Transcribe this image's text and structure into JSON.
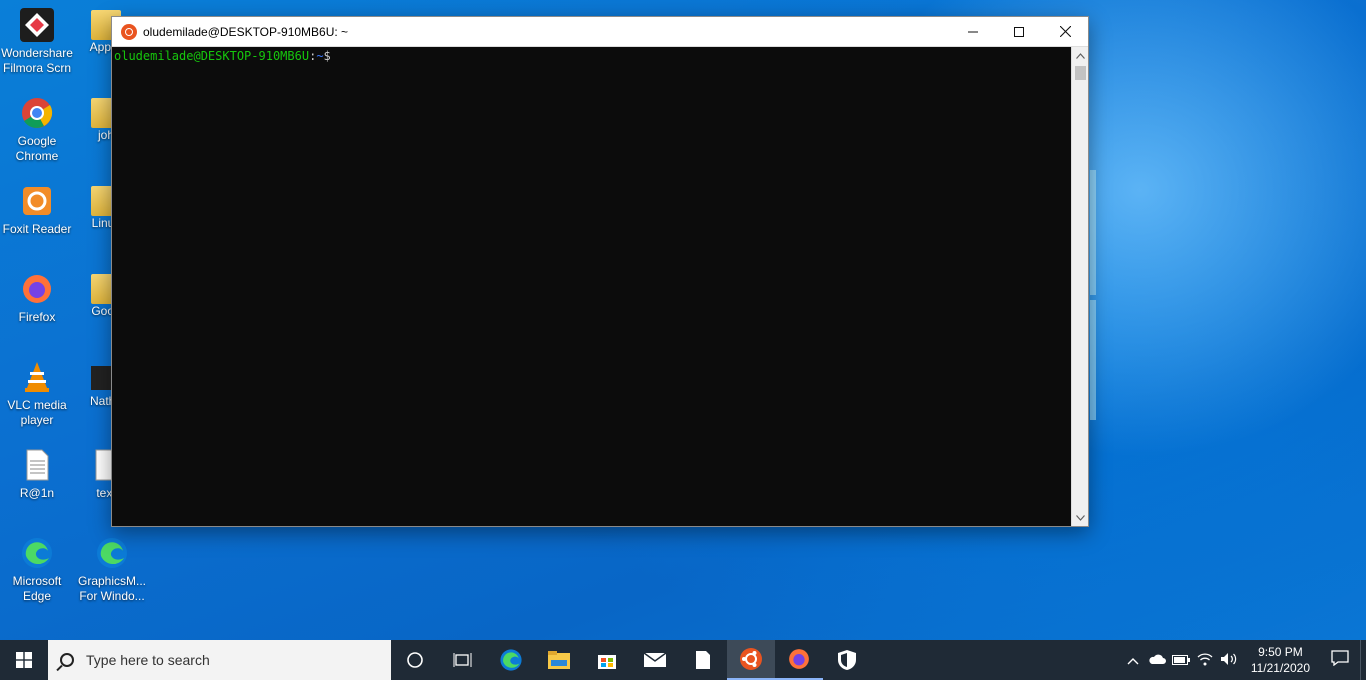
{
  "desktop": {
    "icons": [
      {
        "label": "Wondershare Filmora Scrn"
      },
      {
        "label": "Applic"
      },
      {
        "label": "Google Chrome"
      },
      {
        "label": "joh"
      },
      {
        "label": "Foxit Reader"
      },
      {
        "label": "Linux"
      },
      {
        "label": "Firefox"
      },
      {
        "label": "Good"
      },
      {
        "label": "VLC media player"
      },
      {
        "label": "Natha"
      },
      {
        "label": "R@1n"
      },
      {
        "label": "text"
      },
      {
        "label": "Microsoft Edge"
      },
      {
        "label": "GraphicsM... For Windo..."
      }
    ]
  },
  "window": {
    "title": "oludemilade@DESKTOP-910MB6U: ~",
    "minimize": "—",
    "maximize": "☐",
    "close": "✕",
    "prompt_user": "oludemilade@DESKTOP-910MB6U",
    "prompt_sep": ":",
    "prompt_path": "~",
    "prompt_symbol": "$"
  },
  "taskbar": {
    "search_placeholder": "Type here to search",
    "time": "9:50 PM",
    "date": "11/21/2020"
  },
  "colors": {
    "terminal_bg": "#0c0c0c",
    "prompt_user": "#16c60c",
    "prompt_path": "#3b78ff",
    "taskbar_bg": "#1f2a36",
    "ubuntu_orange": "#e95420"
  }
}
